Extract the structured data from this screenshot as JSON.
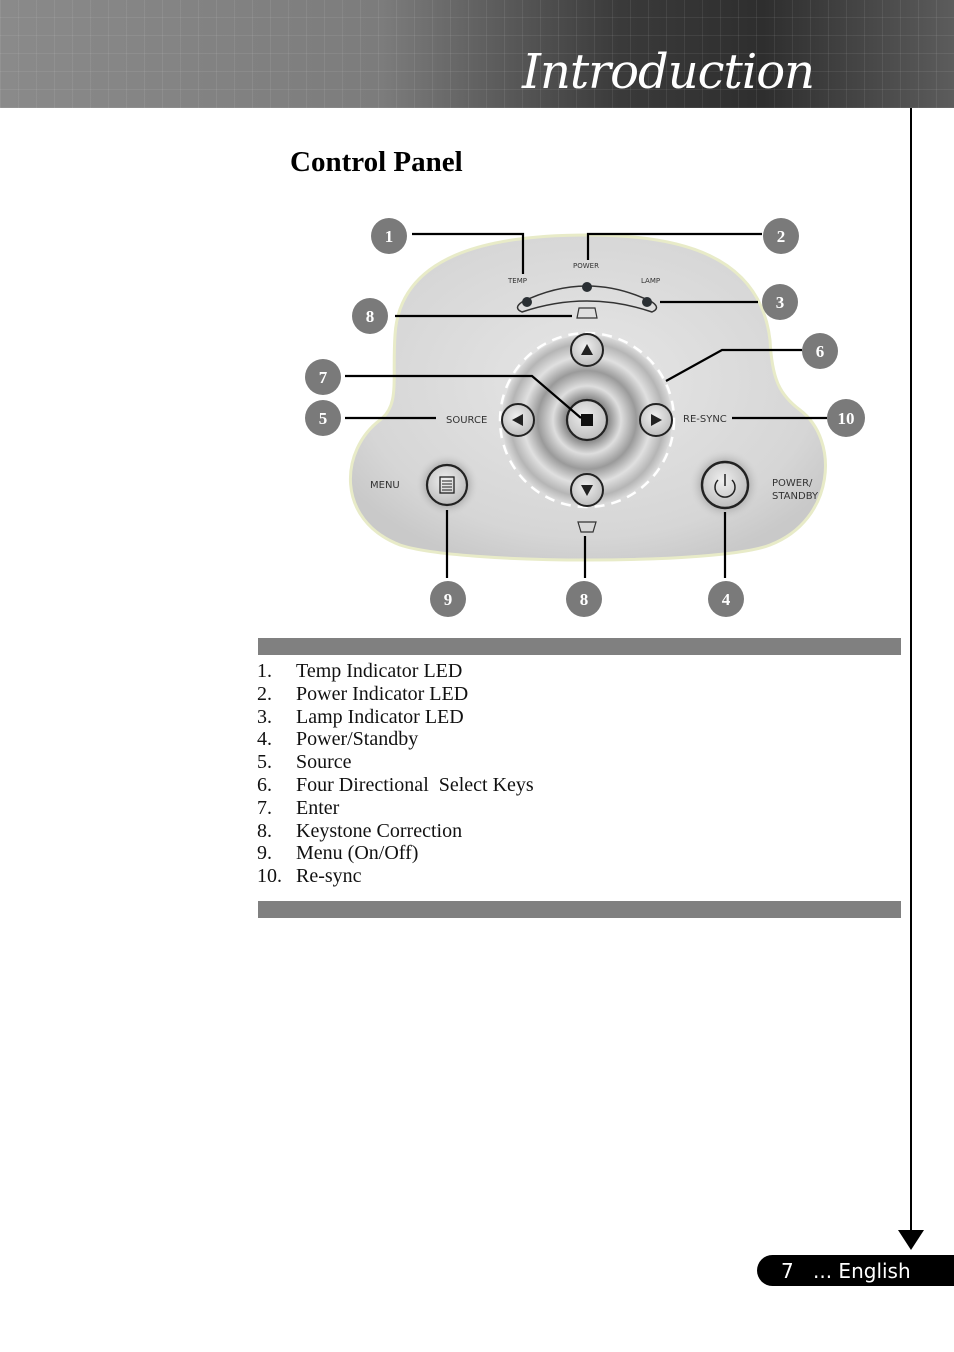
{
  "header": {
    "title": "Introduction"
  },
  "section": {
    "title": "Control Panel"
  },
  "panel": {
    "labels": {
      "temp": "TEMP",
      "power": "POWER",
      "lamp": "LAMP",
      "source": "SOURCE",
      "resync": "RE-SYNC",
      "menu": "MENU",
      "power_standby_line1": "POWER/",
      "power_standby_line2": "STANDBY"
    },
    "callouts": [
      "1",
      "2",
      "3",
      "4",
      "5",
      "6",
      "7",
      "8",
      "9",
      "10"
    ],
    "callout_8_top": "8",
    "callout_8_bottom": "8"
  },
  "legend": {
    "items": [
      {
        "num": "1.",
        "label": "Temp Indicator LED"
      },
      {
        "num": "2.",
        "label": "Power Indicator LED"
      },
      {
        "num": "3.",
        "label": "Lamp Indicator LED"
      },
      {
        "num": "4.",
        "label": "Power/Standby"
      },
      {
        "num": "5.",
        "label": "Source"
      },
      {
        "num": "6.",
        "label": "Four Directional  Select Keys"
      },
      {
        "num": "7.",
        "label": "Enter"
      },
      {
        "num": "8.",
        "label": "Keystone Correction"
      },
      {
        "num": "9.",
        "label": "Menu (On/Off)"
      },
      {
        "num": "10.",
        "label": "Re-sync"
      }
    ]
  },
  "footer": {
    "page_number": "7",
    "language": "... English"
  },
  "colors": {
    "callout_fill": "#7a7a7a",
    "bar_gray": "#808080",
    "footer_bg": "#000000"
  }
}
